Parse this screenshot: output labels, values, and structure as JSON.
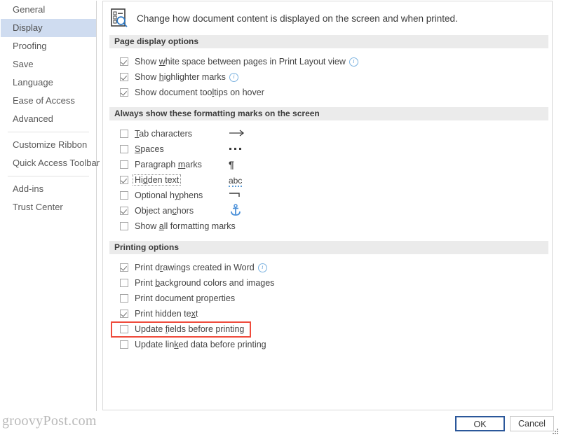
{
  "nav": {
    "items": [
      {
        "label": "General",
        "selected": false,
        "sep_after": false
      },
      {
        "label": "Display",
        "selected": true,
        "sep_after": false
      },
      {
        "label": "Proofing",
        "selected": false,
        "sep_after": false
      },
      {
        "label": "Save",
        "selected": false,
        "sep_after": false
      },
      {
        "label": "Language",
        "selected": false,
        "sep_after": false
      },
      {
        "label": "Ease of Access",
        "selected": false,
        "sep_after": false
      },
      {
        "label": "Advanced",
        "selected": false,
        "sep_after": true
      },
      {
        "label": "Customize Ribbon",
        "selected": false,
        "sep_after": false
      },
      {
        "label": "Quick Access Toolbar",
        "selected": false,
        "sep_after": true
      },
      {
        "label": "Add-ins",
        "selected": false,
        "sep_after": false
      },
      {
        "label": "Trust Center",
        "selected": false,
        "sep_after": false
      }
    ]
  },
  "header": {
    "icon": "document-search-icon",
    "text": "Change how document content is displayed on the screen and when printed."
  },
  "sections": [
    {
      "id": "page-display-options",
      "title": "Page display options",
      "options": [
        {
          "label_pre": "Show ",
          "accel": "w",
          "label_post": "hite space between pages in Print Layout view",
          "checked": true,
          "info": true,
          "symbol": "",
          "focus": false
        },
        {
          "label_pre": "Show ",
          "accel": "h",
          "label_post": "ighlighter marks",
          "checked": true,
          "info": true,
          "symbol": "",
          "focus": false
        },
        {
          "label_pre": "Show document too",
          "accel": "l",
          "label_post": "tips on hover",
          "checked": true,
          "info": false,
          "symbol": "",
          "focus": false
        }
      ]
    },
    {
      "id": "formatting-marks",
      "title": "Always show these formatting marks on the screen",
      "options": [
        {
          "label_pre": "",
          "accel": "T",
          "label_post": "ab characters",
          "checked": false,
          "info": false,
          "symbol": "→",
          "symbol_kind": "arrow",
          "focus": false
        },
        {
          "label_pre": "",
          "accel": "S",
          "label_post": "paces",
          "checked": false,
          "info": false,
          "symbol": "···",
          "symbol_kind": "dots",
          "focus": false
        },
        {
          "label_pre": "Paragraph ",
          "accel": "m",
          "label_post": "arks",
          "checked": false,
          "info": false,
          "symbol": "¶",
          "symbol_kind": "pilcrow",
          "focus": false
        },
        {
          "label_pre": "Hi",
          "accel": "d",
          "label_post": "den text",
          "checked": true,
          "info": false,
          "symbol": "abc",
          "symbol_kind": "abc",
          "focus": true
        },
        {
          "label_pre": "Optional h",
          "accel": "y",
          "label_post": "phens",
          "checked": false,
          "info": false,
          "symbol": "¬",
          "symbol_kind": "hyphen",
          "focus": false
        },
        {
          "label_pre": "Object an",
          "accel": "c",
          "label_post": "hors",
          "checked": true,
          "info": false,
          "symbol": "⚓",
          "symbol_kind": "anchor",
          "focus": false
        },
        {
          "label_pre": "Show ",
          "accel": "a",
          "label_post": "ll formatting marks",
          "checked": false,
          "info": false,
          "symbol": "",
          "focus": false
        }
      ]
    },
    {
      "id": "printing-options",
      "title": "Printing options",
      "options": [
        {
          "label_pre": "Print d",
          "accel": "r",
          "label_post": "awings created in Word",
          "checked": true,
          "info": true,
          "symbol": "",
          "focus": false
        },
        {
          "label_pre": "Print ",
          "accel": "b",
          "label_post": "ackground colors and images",
          "checked": false,
          "info": false,
          "symbol": "",
          "focus": false
        },
        {
          "label_pre": "Print document ",
          "accel": "p",
          "label_post": "roperties",
          "checked": false,
          "info": false,
          "symbol": "",
          "focus": false
        },
        {
          "label_pre": "Print hidden te",
          "accel": "x",
          "label_post": "t",
          "checked": true,
          "info": false,
          "symbol": "",
          "focus": false,
          "highlight": true
        },
        {
          "label_pre": "Update ",
          "accel": "f",
          "label_post": "ields before printing",
          "checked": false,
          "info": false,
          "symbol": "",
          "focus": false
        },
        {
          "label_pre": "Update lin",
          "accel": "k",
          "label_post": "ed data before printing",
          "checked": false,
          "info": false,
          "symbol": "",
          "focus": false
        }
      ]
    }
  ],
  "footer": {
    "ok_label": "OK",
    "cancel_label": "Cancel"
  },
  "watermark": "groovyPost.com",
  "colors": {
    "selection": "#cfdcf0",
    "section_bar": "#ebebeb",
    "highlight_red": "#ef4b3c",
    "ok_focus_border": "#2b579a",
    "accent_blue": "#5a9bd5"
  }
}
